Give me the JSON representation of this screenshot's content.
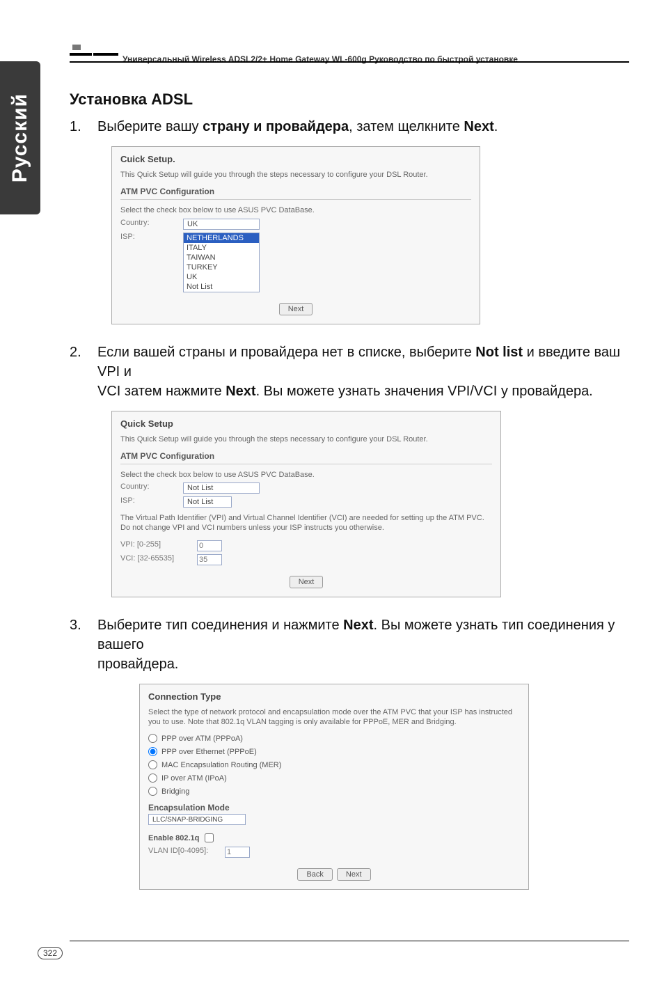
{
  "doc_header": "Универсальный Wireless ADSL2/2+ Home Gateway  WL-600g Руководство по быстрой установке",
  "side_tab": "Русский",
  "page_number": "322",
  "heading": "Установка ADSL",
  "step1": {
    "num": "1.",
    "pre": "Выберите вашу ",
    "bold1": "страну и провайдера",
    "mid": ", затем щелкните ",
    "bold2": "Next",
    "post": "."
  },
  "step2": {
    "num": "2.",
    "line1_pre": "Если вашей страны и провайдера нет в списке, выберите ",
    "line1_bold": "Not list",
    "line1_mid": " и введите ваш VPI и",
    "line2_pre": "VCI затем нажмите ",
    "line2_bold": "Next",
    "line2_post": ". Вы можете узнать значения VPI/VCI у провайдера."
  },
  "step3": {
    "num": "3.",
    "line1_pre": "Выберите тип соединения и нажмите ",
    "line1_bold": "Next",
    "line1_post": ". Вы можете узнать тип соединения у вашего",
    "line2": "провайдера."
  },
  "shot1": {
    "title": "Cuick Setup.",
    "desc": "This Quick Setup will guide you through the steps necessary to configure your DSL Router.",
    "section": "ATM PVC Configuration",
    "hint": "Select the check box below to use ASUS PVC DataBase.",
    "country_lab": "Country:",
    "country_val": "UK",
    "isp_lab": "ISP:",
    "isp_items": [
      "NETHERLANDS",
      "ITALY",
      "TAIWAN",
      "TURKEY",
      "UK",
      "Not List"
    ],
    "next": "Next"
  },
  "shot2": {
    "title": "Quick Setup",
    "desc": "This Quick Setup will guide you through the steps necessary to configure your DSL Router.",
    "section": "ATM PVC Configuration",
    "hint": "Select the check box below to use ASUS PVC DataBase.",
    "country_lab": "Country:",
    "country_val": "Not List",
    "isp_lab": "ISP:",
    "isp_val": "Not List",
    "vpi_desc": "The Virtual Path Identifier (VPI) and Virtual Channel Identifier (VCI) are needed for setting up the ATM PVC. Do not change VPI and VCI numbers unless your ISP instructs you otherwise.",
    "vpi_lab": "VPI: [0-255]",
    "vpi_val": "0",
    "vci_lab": "VCI: [32-65535]",
    "vci_val": "35",
    "next": "Next"
  },
  "shot3": {
    "title": "Connection Type",
    "desc": "Select the type of network protocol and encapsulation mode over the ATM PVC that your ISP has instructed you to use. Note that 802.1q VLAN tagging is only available for PPPoE, MER and Bridging.",
    "r1": "PPP over ATM (PPPoA)",
    "r2": "PPP over Ethernet (PPPoE)",
    "r3": "MAC Encapsulation Routing (MER)",
    "r4": "IP over ATM (IPoA)",
    "r5": "Bridging",
    "enc_lab": "Encapsulation Mode",
    "enc_val": "LLC/SNAP-BRIDGING",
    "enable_lab": "Enable 802.1q",
    "vlan_lab": "VLAN ID[0-4095]:",
    "vlan_val": "1",
    "back": "Back",
    "next": "Next"
  }
}
